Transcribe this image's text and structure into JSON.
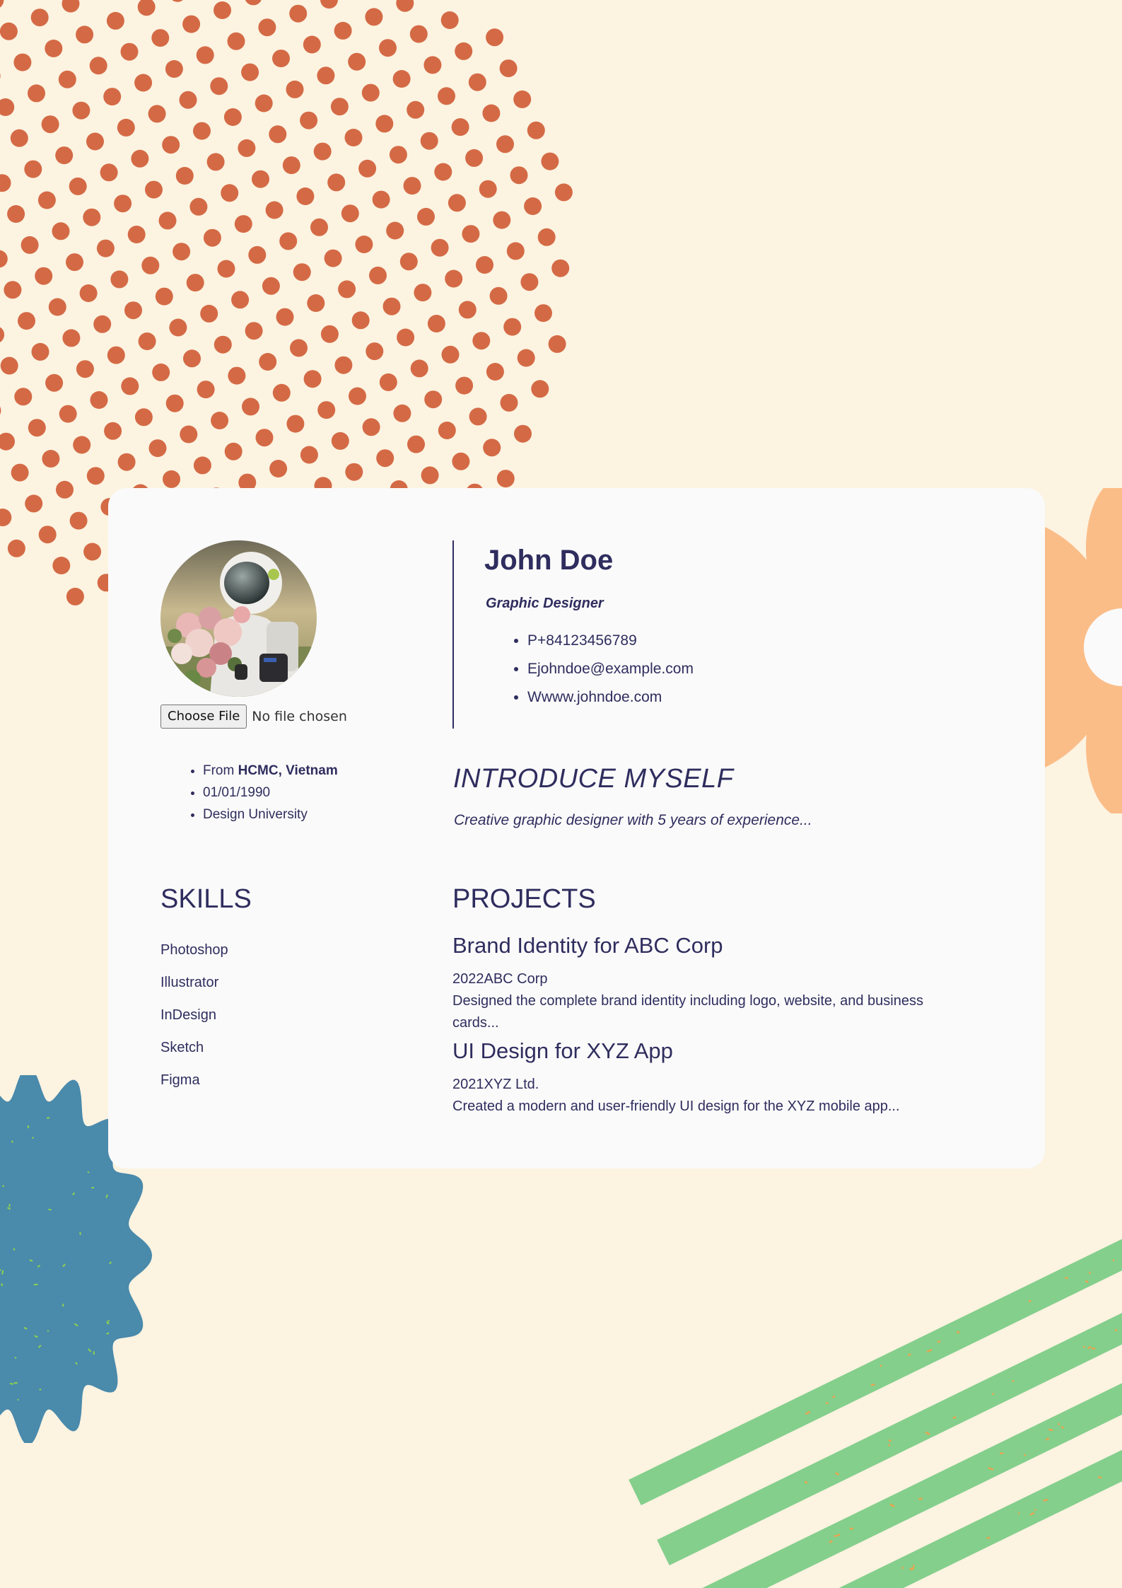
{
  "colors": {
    "background": "#fcf3e1",
    "card": "#fafafa",
    "text": "#2f2d5e",
    "dots": "#d46a45",
    "flower": "#fbbd88",
    "blob": "#4a8aab",
    "stripes": "#84cf8c",
    "speckle_green": "#8fd14f",
    "speckle_orange": "#e7a44f"
  },
  "profile": {
    "name": "John Doe",
    "title": "Graphic Designer",
    "contacts": [
      "P+84123456789",
      "Ejohndoe@example.com",
      "Wwww.johndoe.com"
    ],
    "photo_description": "astronaut-holding-flowers",
    "file_input": {
      "button_label": "Choose File",
      "status": "No file chosen"
    },
    "details": {
      "from_label": "From ",
      "from_value": "HCMC, Vietnam",
      "birthdate": "01/01/1990",
      "education": "Design University"
    }
  },
  "intro": {
    "heading": "INTRODUCE MYSELF",
    "text": "Creative graphic designer with 5 years of experience..."
  },
  "skills": {
    "heading": "SKILLS",
    "items": [
      "Photoshop",
      "Illustrator",
      "InDesign",
      "Sketch",
      "Figma"
    ]
  },
  "projects": {
    "heading": "PROJECTS",
    "items": [
      {
        "title": "Brand Identity for ABC Corp",
        "meta": "2022ABC Corp",
        "description": "Designed the complete brand identity including logo, website, and business cards..."
      },
      {
        "title": "UI Design for XYZ App",
        "meta": "2021XYZ Ltd.",
        "description": "Created a modern and user-friendly UI design for the XYZ mobile app..."
      }
    ]
  }
}
